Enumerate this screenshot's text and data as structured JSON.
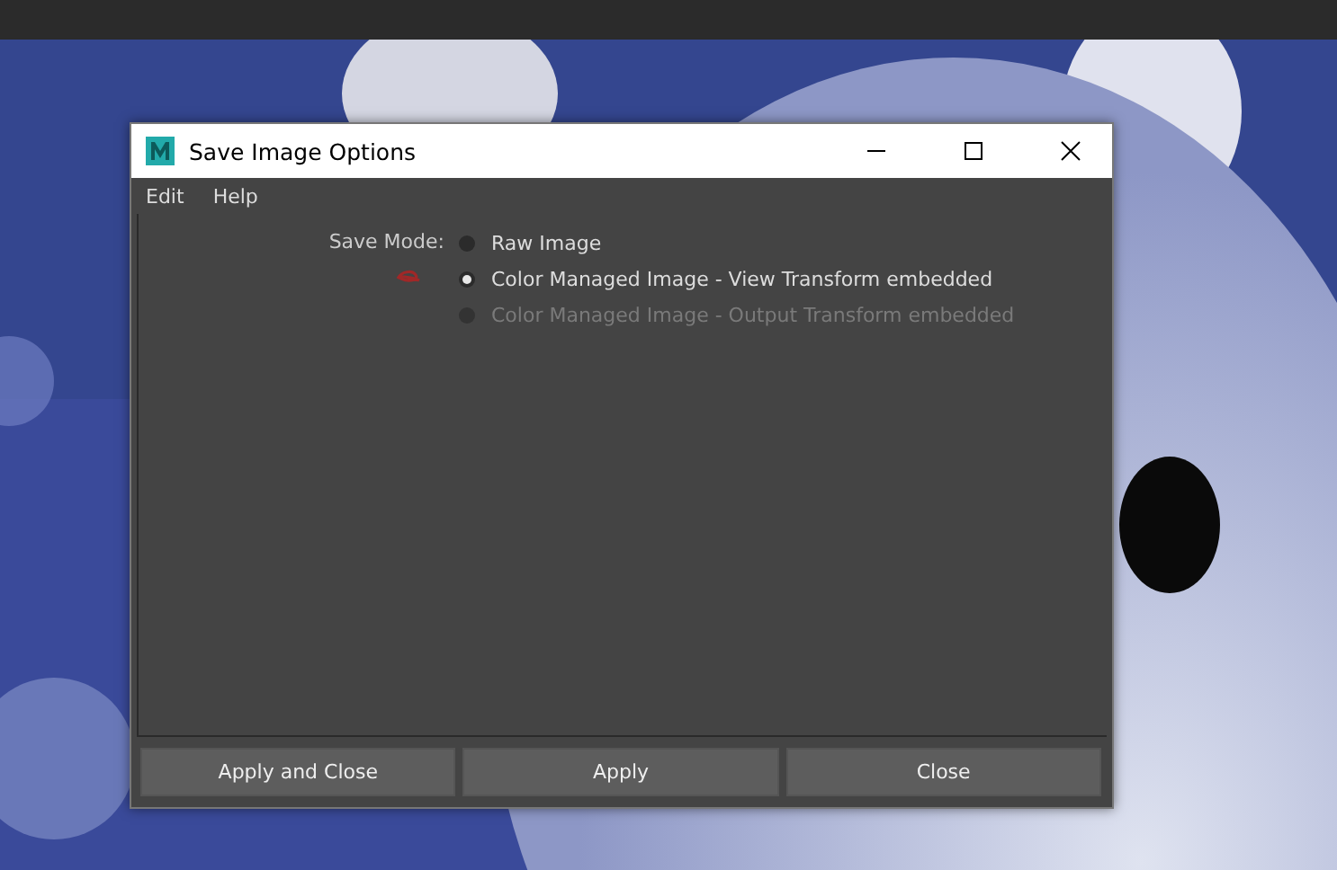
{
  "window": {
    "title": "Save Image Options"
  },
  "menu": [
    {
      "label": "Edit"
    },
    {
      "label": "Help"
    }
  ],
  "save_mode": {
    "label": "Save Mode:",
    "options": [
      {
        "label": "Raw Image",
        "selected": false,
        "disabled": false
      },
      {
        "label": "Color Managed Image - View Transform embedded",
        "selected": true,
        "disabled": false
      },
      {
        "label": "Color Managed Image - Output Transform embedded",
        "selected": false,
        "disabled": true
      }
    ]
  },
  "buttons": [
    {
      "label": "Apply and Close"
    },
    {
      "label": "Apply"
    },
    {
      "label": "Close"
    }
  ]
}
